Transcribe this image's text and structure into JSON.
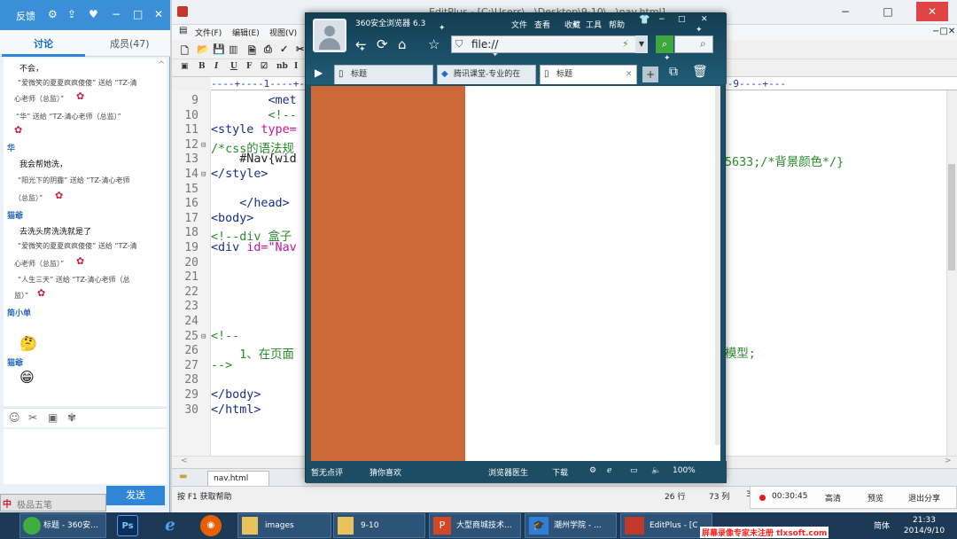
{
  "chat": {
    "title_btn": "反馈",
    "tabs": {
      "discuss": "讨论",
      "members": "成员(47)"
    },
    "messages": [
      {
        "kind": "text",
        "t": "不会，"
      },
      {
        "kind": "gift",
        "t": "“爱微笑的夏夏疯疯傻傻”  送给  “TZ-清"
      },
      {
        "kind": "gift",
        "t": "心老师（总监）”"
      },
      {
        "kind": "gift",
        "t": "“华”  送给  “TZ-清心老师（总监）”"
      },
      {
        "kind": "user",
        "t": "华"
      },
      {
        "kind": "text",
        "t": "我会帮她洗，"
      },
      {
        "kind": "gift",
        "t": "“阳光下的阴霾”  送给  “TZ-清心老师"
      },
      {
        "kind": "gift",
        "t": "（总监）”"
      },
      {
        "kind": "user",
        "t": "猫爺"
      },
      {
        "kind": "text",
        "t": "去洗头房洗洗就是了"
      },
      {
        "kind": "gift",
        "t": "“爱微笑的夏夏疯疯傻傻”  送给  “TZ-清"
      },
      {
        "kind": "gift",
        "t": "心老师（总监）”"
      },
      {
        "kind": "gift",
        "t": "“人生三天”  送给  “TZ-清心老师（总"
      },
      {
        "kind": "gift",
        "t": "监）”"
      },
      {
        "kind": "user",
        "t": "简小单"
      },
      {
        "kind": "user",
        "t": "猫爺"
      }
    ],
    "send": "发送",
    "ime": {
      "zh": "中",
      "name": "极品五笔"
    }
  },
  "editor": {
    "title": "EditPlus - [C:\\Users\\...\\Desktop\\9-10\\...\\nav.html]",
    "menu": [
      "文件(F)",
      "编辑(E)",
      "视图(V)"
    ],
    "format_btns": [
      "B",
      "I",
      "U",
      "F",
      "☑",
      "nb",
      "I",
      "⌬"
    ],
    "ruler": "----+----1----+----2----+----3----+----4----+----5----+----6----+----7----+----8----+----9----+---",
    "lines": [
      {
        "n": "9",
        "fold": "",
        "parts": [
          {
            "c": "tag",
            "t": "        <met"
          }
        ]
      },
      {
        "n": "10",
        "fold": "",
        "parts": [
          {
            "c": "cmt",
            "t": "        <!--"
          }
        ]
      },
      {
        "n": "11",
        "fold": "",
        "parts": [
          {
            "c": "tag",
            "t": "<style "
          },
          {
            "c": "str",
            "t": "type="
          }
        ]
      },
      {
        "n": "12",
        "fold": "⊟",
        "parts": [
          {
            "c": "cmt",
            "t": "/*css的语法规"
          }
        ]
      },
      {
        "n": "13",
        "fold": "",
        "parts": [
          {
            "c": "blk",
            "t": "    #Nav{wid"
          }
        ]
      },
      {
        "n": "14",
        "fold": "⊟",
        "parts": [
          {
            "c": "tag",
            "t": "</style>"
          }
        ]
      },
      {
        "n": "15",
        "fold": "",
        "parts": [
          {
            "c": "tag",
            "t": ""
          }
        ]
      },
      {
        "n": "16",
        "fold": "",
        "parts": [
          {
            "c": "tag",
            "t": "    </head>"
          }
        ]
      },
      {
        "n": "17",
        "fold": "",
        "parts": [
          {
            "c": "tag",
            "t": "<body>"
          }
        ]
      },
      {
        "n": "18",
        "fold": "",
        "parts": [
          {
            "c": "cmt",
            "t": "<!--div 盒子"
          }
        ]
      },
      {
        "n": "19",
        "fold": "",
        "parts": [
          {
            "c": "tag",
            "t": "<div "
          },
          {
            "c": "str",
            "t": "id=\"Nav"
          }
        ]
      },
      {
        "n": "20",
        "fold": "",
        "parts": []
      },
      {
        "n": "21",
        "fold": "",
        "parts": []
      },
      {
        "n": "22",
        "fold": "",
        "parts": []
      },
      {
        "n": "23",
        "fold": "",
        "parts": []
      },
      {
        "n": "24",
        "fold": "",
        "parts": []
      },
      {
        "n": "25",
        "fold": "⊟",
        "parts": [
          {
            "c": "cmt",
            "t": "<!--"
          }
        ]
      },
      {
        "n": "26",
        "fold": "",
        "parts": [
          {
            "c": "cmt",
            "t": "    1、在页面"
          }
        ]
      },
      {
        "n": "27",
        "fold": "",
        "parts": [
          {
            "c": "cmt",
            "t": "-->"
          }
        ]
      },
      {
        "n": "28",
        "fold": "",
        "parts": []
      },
      {
        "n": "29",
        "fold": "",
        "parts": [
          {
            "c": "tag",
            "t": "</body>"
          }
        ]
      },
      {
        "n": "30",
        "fold": "",
        "parts": [
          {
            "c": "tag",
            "t": "</html>"
          }
        ]
      }
    ],
    "right_line13": "5633;/*背景颜色*/}",
    "right_line26": "模型;",
    "file_tab": "nav.html",
    "status": {
      "help": "按 F1 获取帮助",
      "row": "26 行",
      "col": "73 列",
      "num": "3"
    }
  },
  "browser": {
    "name": "360安全浏览器 6.3",
    "menu": [
      "文件",
      "查看",
      "收藏",
      "工具",
      "帮助"
    ],
    "address": "file://",
    "tabs": [
      "标题",
      "腾讯课堂-专业的在",
      "标题"
    ],
    "status": {
      "smart": "暂无点评",
      "guess": "猜你喜欢",
      "doctor": "浏览器医生",
      "download": "下载",
      "zoom": "100%"
    },
    "div_color": "#cd6838"
  },
  "recorder": {
    "time": "00:30:45",
    "hd": "高清",
    "preview": "预览",
    "quit": "退出分享"
  },
  "taskbar": {
    "items": [
      "标题 - 360安...",
      "images",
      "9-10",
      "大型商城技术...",
      "潮州学院 - ...",
      "EditPlus - [C"
    ],
    "lang": "简体",
    "time": "21:33",
    "date": "2014/9/10",
    "watermark": "屏幕录像专家未注册 tlxsoft.com"
  }
}
